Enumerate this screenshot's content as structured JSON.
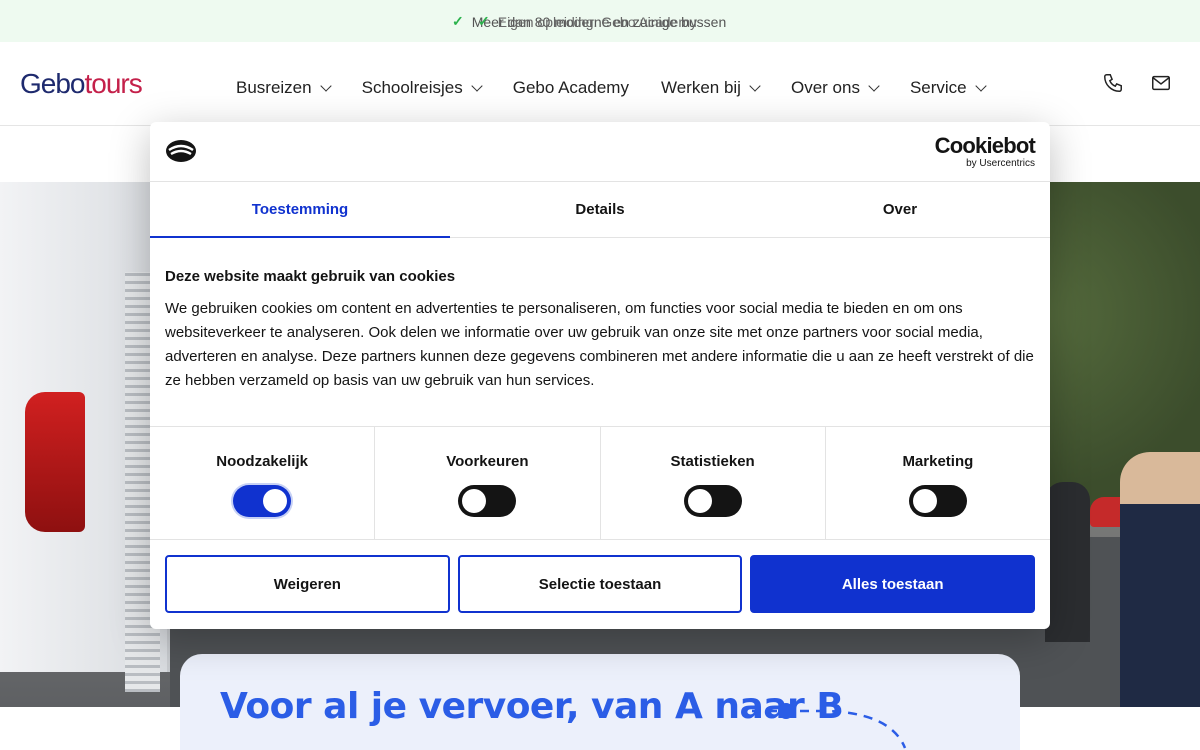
{
  "announcement": {
    "message_primary": "Meer dan 80 moderne en zuinige bussen",
    "message_secondary": "Eigen opleiding: Gebo Academy"
  },
  "header": {
    "logo_part1": "Gebo",
    "logo_part2": "tours",
    "nav": [
      {
        "label": "Busreizen",
        "has_dropdown": true
      },
      {
        "label": "Schoolreisjes",
        "has_dropdown": true
      },
      {
        "label": "Gebo Academy",
        "has_dropdown": false
      },
      {
        "label": "Werken bij",
        "has_dropdown": true
      },
      {
        "label": "Over ons",
        "has_dropdown": true
      },
      {
        "label": "Service",
        "has_dropdown": true
      }
    ],
    "icons": [
      "phone-icon",
      "mail-icon"
    ]
  },
  "hero": {
    "title": "Voor al je vervoer, van A naar B"
  },
  "cookie": {
    "brand_name": "Cookiebot",
    "brand_sub": "by Usercentrics",
    "tabs": [
      {
        "label": "Toestemming",
        "active": true
      },
      {
        "label": "Details",
        "active": false
      },
      {
        "label": "Over",
        "active": false
      }
    ],
    "heading": "Deze website maakt gebruik van cookies",
    "body": "We gebruiken cookies om content en advertenties te personaliseren, om functies voor social media te bieden en om ons websiteverkeer te analyseren. Ook delen we informatie over uw gebruik van onze site met onze partners voor social media, adverteren en analyse. Deze partners kunnen deze gegevens combineren met andere informatie die u aan ze heeft verstrekt of die ze hebben verzameld op basis van uw gebruik van hun services.",
    "categories": [
      {
        "label": "Noodzakelijk",
        "checked": true
      },
      {
        "label": "Voorkeuren",
        "checked": false
      },
      {
        "label": "Statistieken",
        "checked": false
      },
      {
        "label": "Marketing",
        "checked": false
      }
    ],
    "buttons": {
      "reject": "Weigeren",
      "selection": "Selectie toestaan",
      "accept_all": "Alles toestaan"
    },
    "accent_color": "#1032cf"
  }
}
